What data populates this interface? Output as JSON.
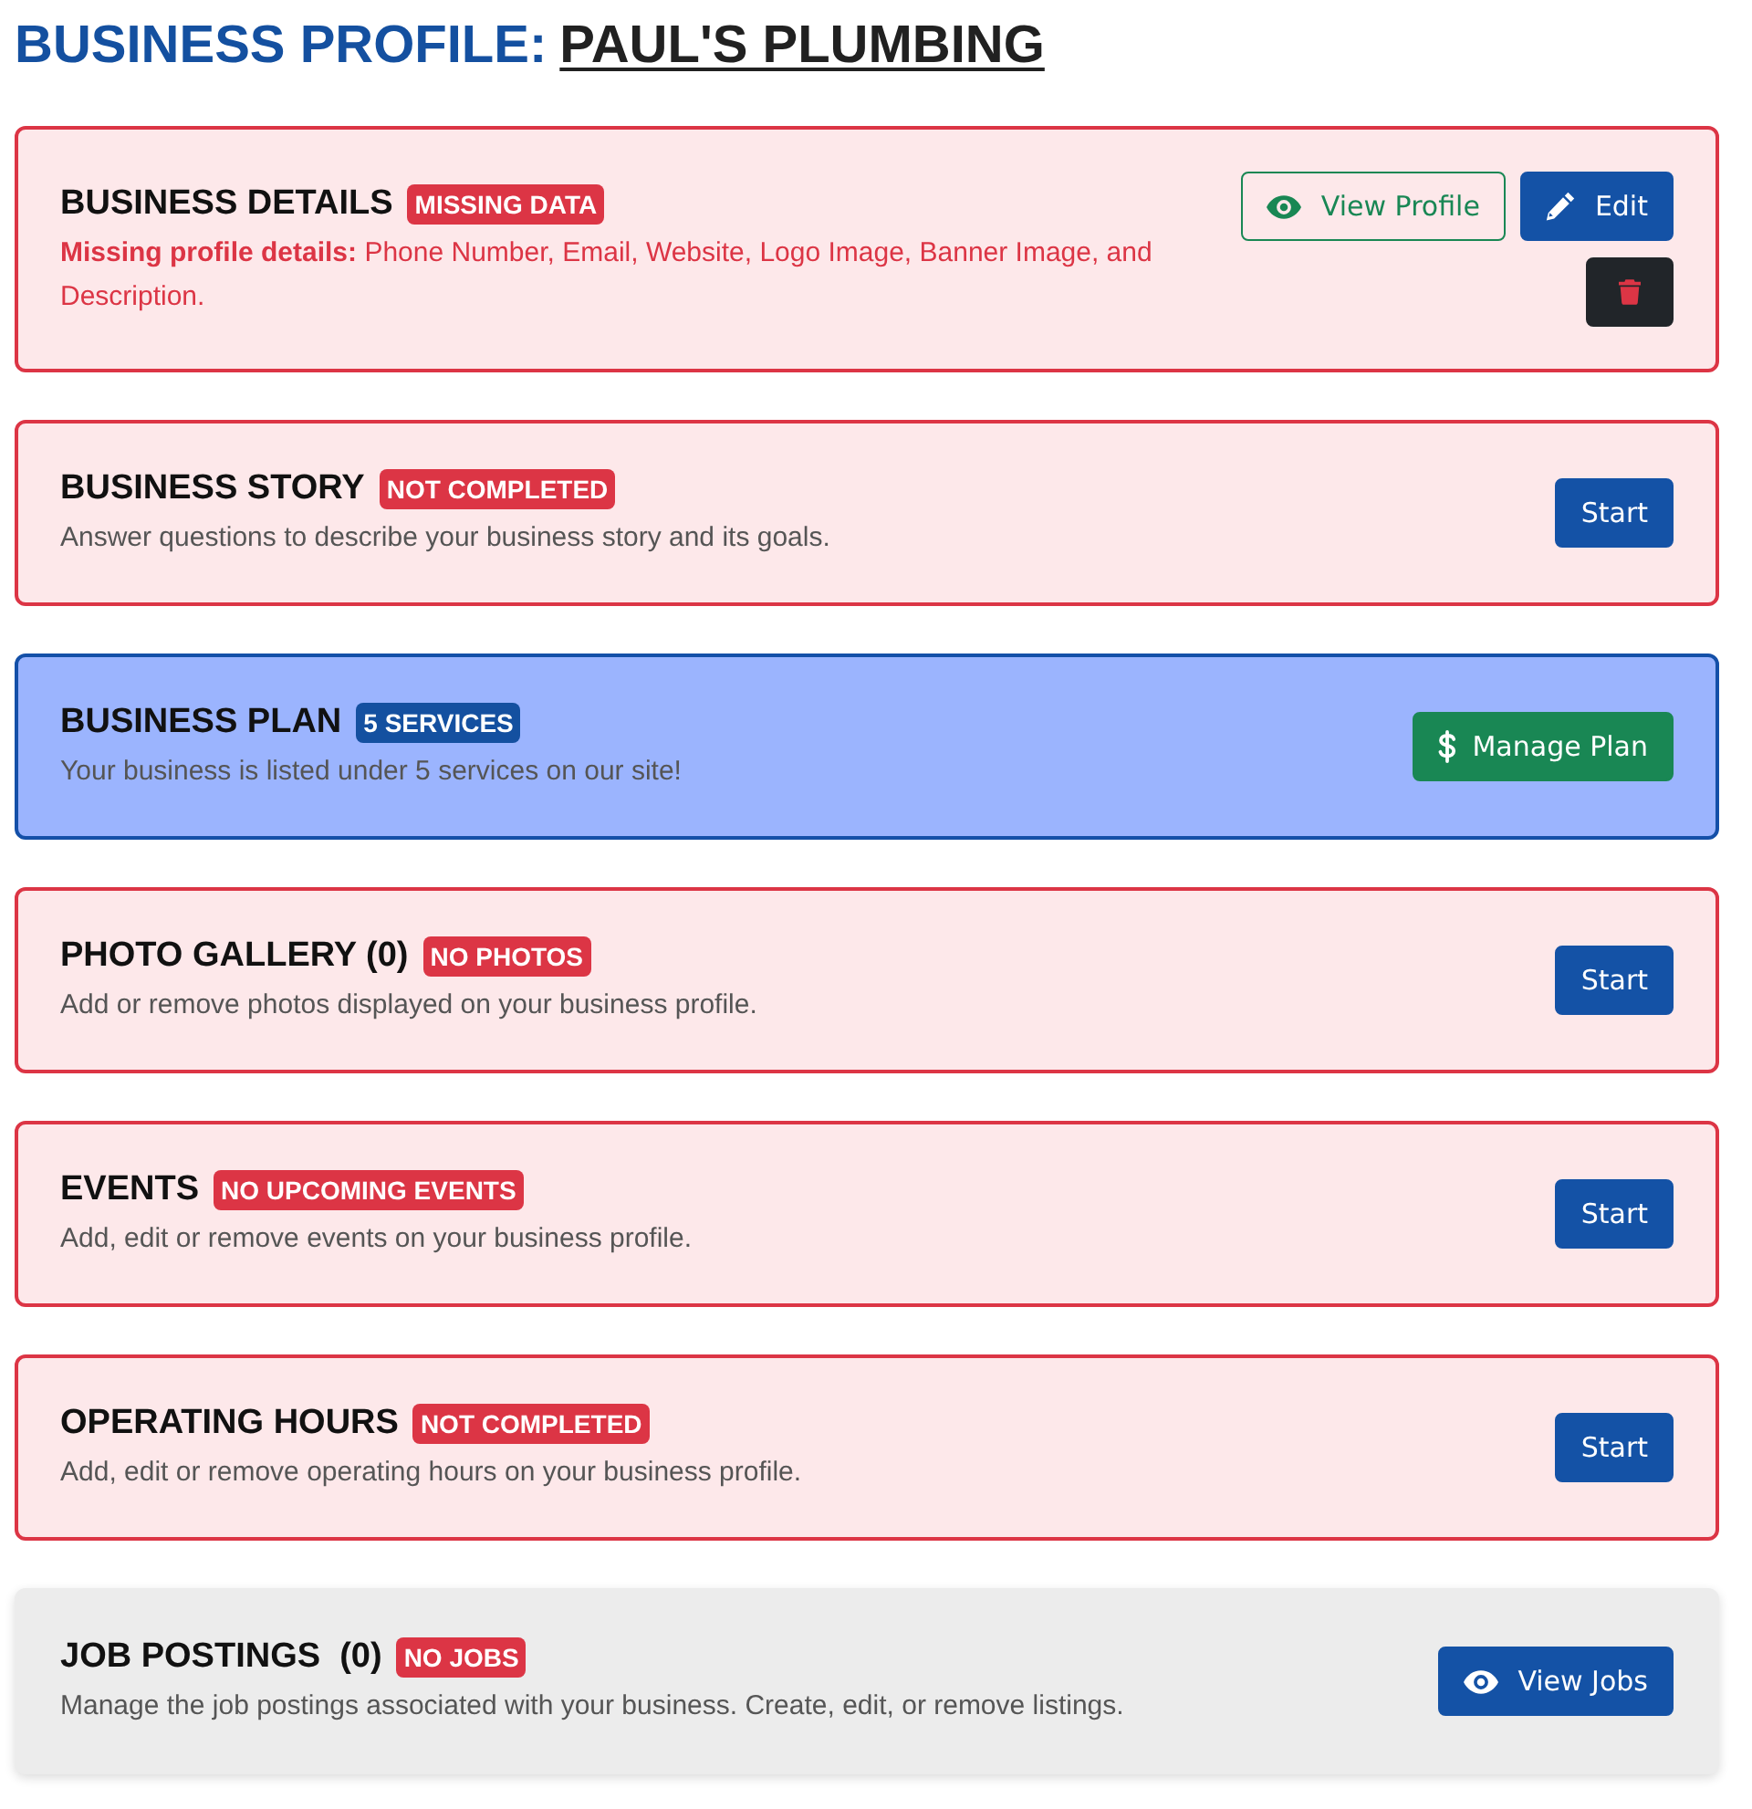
{
  "heading": {
    "label": "BUSINESS PROFILE:",
    "name": "PAUL'S PLUMBING"
  },
  "cards": [
    {
      "kind": "alert",
      "title": "BUSINESS DETAILS",
      "badge": {
        "text": "MISSING DATA",
        "color": "#dc3545"
      },
      "description": {
        "kind": "error",
        "text": "**Missing profile details:** Phone Number, Email, Website, Logo Image, Banner Image, and Description."
      },
      "buttons": [
        {
          "kind": "view-outline",
          "label": "View Profile"
        },
        {
          "kind": "edit",
          "label": "Edit"
        },
        {
          "kind": "delete"
        }
      ]
    },
    {
      "kind": "alert",
      "title": "BUSINESS STORY",
      "badge": {
        "text": "NOT COMPLETED",
        "color": "#dc3545"
      },
      "description": {
        "kind": "note",
        "text": "Answer questions to describe your business story and its goals."
      },
      "buttons": [
        {
          "kind": "start",
          "label": "Start"
        }
      ]
    },
    {
      "kind": "info",
      "title": "BUSINESS PLAN",
      "badge": {
        "text": "5 SERVICES",
        "color": "#1450a0"
      },
      "description": {
        "kind": "note",
        "text": "Your business is listed under 5 services on our site!"
      },
      "buttons": [
        {
          "kind": "manage",
          "label": "Manage Plan"
        }
      ]
    },
    {
      "kind": "alert",
      "title": "PHOTO GALLERY (0)",
      "badge": {
        "text": "NO PHOTOS",
        "color": "#dc3545"
      },
      "description": {
        "kind": "note",
        "text": "Add or remove photos displayed on your business profile."
      },
      "buttons": [
        {
          "kind": "start",
          "label": "Start"
        }
      ]
    },
    {
      "kind": "alert",
      "title": "EVENTS",
      "badge": {
        "text": "NO UPCOMING EVENTS",
        "color": "#dc3545"
      },
      "description": {
        "kind": "note",
        "text": "Add, edit or remove events on your business profile."
      },
      "buttons": [
        {
          "kind": "start",
          "label": "Start"
        }
      ]
    },
    {
      "kind": "alert",
      "title": "OPERATING HOURS",
      "badge": {
        "text": "NOT COMPLETED",
        "color": "#dc3545"
      },
      "description": {
        "kind": "note",
        "text": "Add, edit or remove operating hours on your business profile."
      },
      "buttons": [
        {
          "kind": "start",
          "label": "Start"
        }
      ]
    },
    {
      "kind": "plain",
      "title": "JOB POSTINGS  (0)",
      "badge": {
        "text": "NO JOBS",
        "color": "#dc3545"
      },
      "description": {
        "kind": "note",
        "text": "Manage the job postings associated with your business. Create, edit, or remove listings."
      },
      "buttons": [
        {
          "kind": "view",
          "label": "View Jobs"
        }
      ]
    }
  ]
}
